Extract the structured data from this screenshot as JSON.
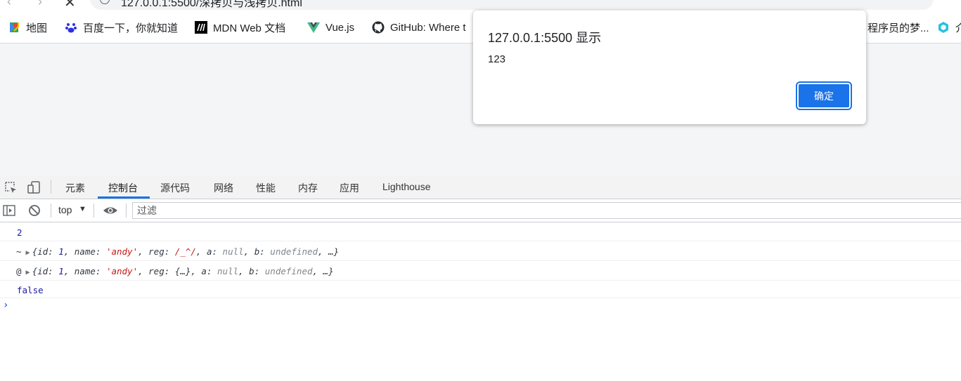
{
  "browser": {
    "url": "127.0.0.1:5500/深拷贝与浅拷贝.html",
    "bookmarks": [
      {
        "label": "地图",
        "icon": "maps-icon"
      },
      {
        "label": "百度一下，你就知道",
        "icon": "baidu-icon"
      },
      {
        "label": "MDN Web 文档",
        "icon": "mdn-icon"
      },
      {
        "label": "Vue.js",
        "icon": "vue-icon"
      },
      {
        "label": "GitHub: Where t",
        "icon": "github-icon"
      },
      {
        "label": "程序员的梦...",
        "icon": "bookmark-icon"
      },
      {
        "label": "介",
        "icon": "app-icon"
      }
    ]
  },
  "dialog": {
    "title": "127.0.0.1:5500 显示",
    "message": "123",
    "ok_label": "确定"
  },
  "devtools": {
    "tabs": [
      "元素",
      "控制台",
      "源代码",
      "网络",
      "性能",
      "内存",
      "应用",
      "Lighthouse"
    ],
    "active_tab": "控制台",
    "context": "top",
    "filter_placeholder": "过滤"
  },
  "console": {
    "line1": "2",
    "line2": {
      "prefix": "~",
      "open": "{",
      "id_key": "id: ",
      "id_val": "1",
      "name_key": ", name: ",
      "name_val": "'andy'",
      "reg_key": ", reg: ",
      "reg_val": "/_^/",
      "a_key": ", a: ",
      "a_val": "null",
      "b_key": ", b: ",
      "b_val": "undefined",
      "close": ", …}"
    },
    "line3": {
      "prefix": "@",
      "open": "{",
      "id_key": "id: ",
      "id_val": "1",
      "name_key": ", name: ",
      "name_val": "'andy'",
      "reg_key": ", reg: ",
      "reg_val": "{…}",
      "a_key": ", a: ",
      "a_val": "null",
      "b_key": ", b: ",
      "b_val": "undefined",
      "close": ", …}"
    },
    "line4": "false",
    "prompt": "›"
  }
}
